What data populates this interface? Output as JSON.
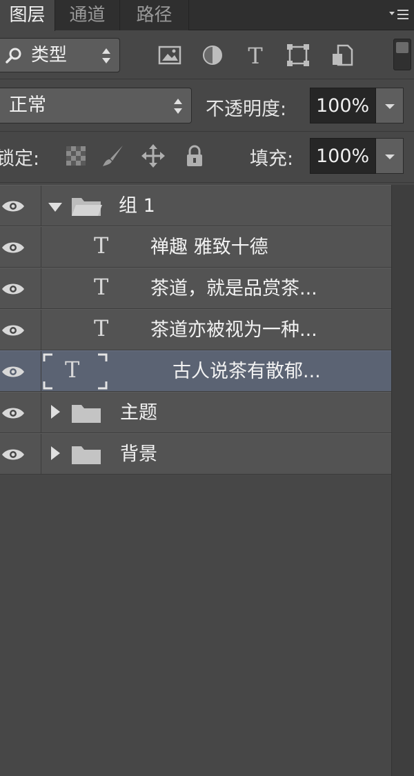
{
  "tabs": [
    {
      "label": "图层",
      "active": true
    },
    {
      "label": "通道",
      "active": false
    },
    {
      "label": "路径",
      "active": false
    }
  ],
  "filter": {
    "kind_label": "类型",
    "icons": [
      "image-filter-icon",
      "adjustment-filter-icon",
      "type-filter-icon",
      "shape-filter-icon",
      "smart-object-filter-icon"
    ]
  },
  "blend": {
    "mode": "正常",
    "opacity_label": "不透明度:",
    "opacity_value": "100%"
  },
  "lock": {
    "label": "锁定:",
    "fill_label": "填充:",
    "fill_value": "100%"
  },
  "layers": [
    {
      "type": "group",
      "expanded": true,
      "name": "组 1",
      "indent": 0,
      "selected": false
    },
    {
      "type": "text",
      "name": "禅趣  雅致十德",
      "indent": 1,
      "selected": false
    },
    {
      "type": "text",
      "name": "茶道，就是品赏茶...",
      "indent": 1,
      "selected": false
    },
    {
      "type": "text",
      "name": "茶道亦被视为一种...",
      "indent": 1,
      "selected": false
    },
    {
      "type": "text",
      "name": "古人说茶有散郁...",
      "indent": 1,
      "selected": true
    },
    {
      "type": "group",
      "expanded": false,
      "name": "主题",
      "indent": 0,
      "selected": false
    },
    {
      "type": "group",
      "expanded": false,
      "name": "背景",
      "indent": 0,
      "selected": false
    }
  ],
  "colors": {
    "panel_bg": "#474747",
    "row_bg": "#535353",
    "selected_row_bg": "#5b6373",
    "field_bg": "#262626"
  }
}
